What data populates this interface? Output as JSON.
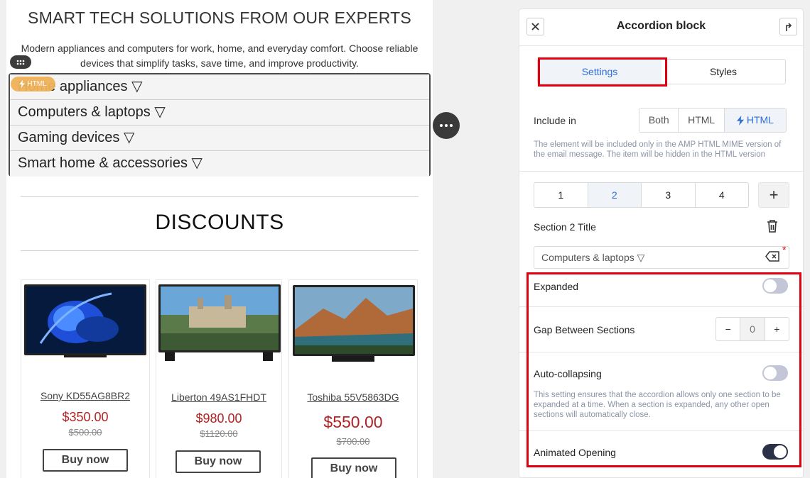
{
  "email": {
    "hero_title": "SMART TECH SOLUTIONS FROM OUR EXPERTS",
    "hero_description": "Modern appliances and computers for work, home, and everyday comfort. Choose reliable devices that simplify tasks, save time, and improve productivity.",
    "html_badge": "HTML",
    "accordion": [
      "Home appliances ▽",
      "Computers & laptops ▽",
      "Gaming devices ▽",
      "Smart home & accessories ▽"
    ],
    "discounts_title": "DISCOUNTS",
    "products": [
      {
        "name": "Sony KD55AG8BR2",
        "price": "$350.00",
        "old_price": "$500.00",
        "button": "Buy now"
      },
      {
        "name": "Liberton 49AS1FHDT",
        "price": "$980.00",
        "old_price": "$1120.00",
        "button": "Buy now"
      },
      {
        "name": "Toshiba 55V5863DG",
        "price": "$550.00",
        "old_price": "$700.00",
        "button": "Buy now"
      }
    ]
  },
  "panel": {
    "title": "Accordion block",
    "tabs": [
      "Settings",
      "Styles"
    ],
    "active_tab": "Settings",
    "include_label": "Include in",
    "include_options": [
      "Both",
      "HTML",
      "HTML"
    ],
    "include_selected": "AMP HTML",
    "include_note": "The element will be included only in the AMP HTML MIME version of the email message. The item will be hidden in the HTML version",
    "sections": [
      "1",
      "2",
      "3",
      "4"
    ],
    "active_section": "2",
    "add_section": "+",
    "section_title_label": "Section 2 Title",
    "section_title_value": "Computers & laptops ▽",
    "required_mark": "*",
    "expanded_label": "Expanded",
    "expanded": false,
    "gap_label": "Gap Between Sections",
    "gap_value": "0",
    "gap_minus": "−",
    "gap_plus": "+",
    "autocollapse_label": "Auto-collapsing",
    "autocollapse": false,
    "autocollapse_note": "This setting ensures that the accordion allows only one section to be expanded at a time. When a section is expanded, any other open sections will automatically close.",
    "animated_label": "Animated Opening",
    "animated": true
  },
  "colors": {
    "accent": "#2f6fd6",
    "highlight": "#e0000f",
    "price": "#b22222",
    "toggle_on": "#2b3146",
    "toggle_off": "#c3c6d6",
    "badge": "#f0b25a"
  }
}
